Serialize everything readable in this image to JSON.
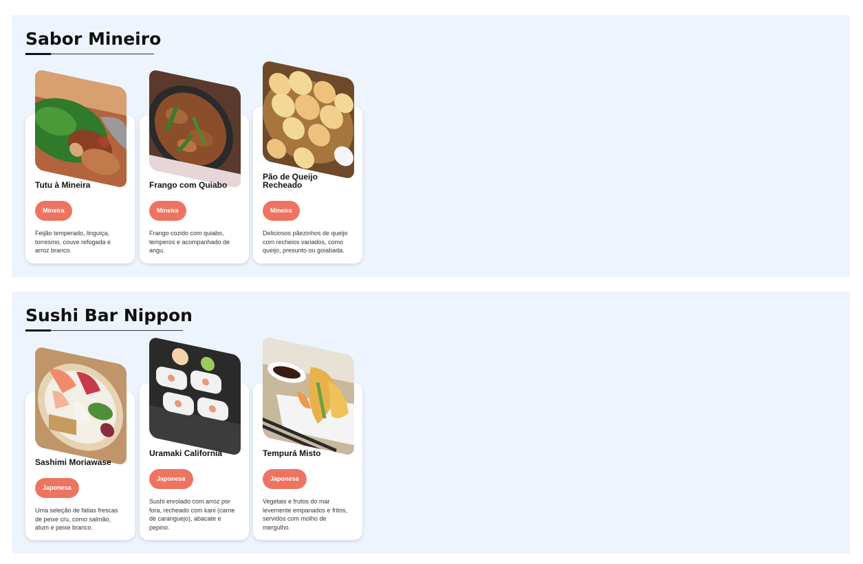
{
  "sections": [
    {
      "title": "Sabor Mineiro",
      "items": [
        {
          "name": "Tutu à Mineira",
          "tag": "Mineira",
          "description": "Feijão temperado, linguiça, torresmo, couve refogada e arroz branco.",
          "image_icon": "tutu-dish-photo"
        },
        {
          "name": "Frango com Quiabo",
          "tag": "Mineira",
          "description": "Frango cozido com quiabo, temperos e acompanhado de angu.",
          "image_icon": "chicken-okra-photo"
        },
        {
          "name": "Pão de Queijo Recheado",
          "tag": "Mineira",
          "description": "Deliciosos pãezinhos de queijo com recheios variados, como queijo, presunto ou goiabada.",
          "image_icon": "cheese-bread-photo"
        }
      ]
    },
    {
      "title": "Sushi Bar Nippon",
      "items": [
        {
          "name": "Sashimi Moriawase",
          "tag": "Japonesa",
          "description": "Uma seleção de fatias frescas de peixe cru, como salmão, atum e peixe branco.",
          "image_icon": "sashimi-photo"
        },
        {
          "name": "Uramaki California",
          "tag": "Japonesa",
          "description": "Sushi enrolado com arroz por fora, recheado com kani (carne de caranguejo), abacate e pepino.",
          "image_icon": "uramaki-photo"
        },
        {
          "name": "Tempurá Misto",
          "tag": "Japonesa",
          "description": "Vegetais e frutos do mar levemente empanados e fritos, servidos com molho de mergulho.",
          "image_icon": "tempura-photo"
        }
      ]
    }
  ],
  "colors": {
    "section_background": "#eef4fd",
    "badge": "#ec7461",
    "card": "#ffffff"
  }
}
